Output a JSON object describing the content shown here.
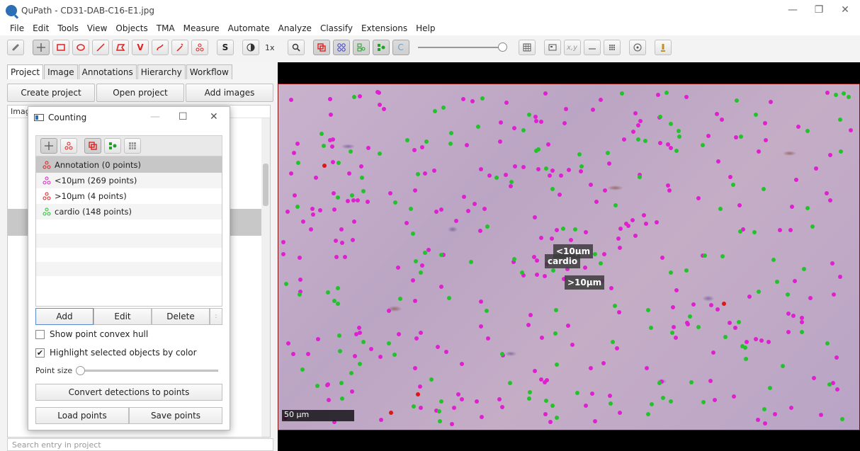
{
  "window": {
    "title": "QuPath - CD31-DAB-C16-E1.jpg"
  },
  "menu": [
    "File",
    "Edit",
    "Tools",
    "View",
    "Objects",
    "TMA",
    "Measure",
    "Automate",
    "Analyze",
    "Classify",
    "Extensions",
    "Help"
  ],
  "toolbar": {
    "zoom_text": "1x",
    "coords_label": "x,y",
    "polygon_label": "V",
    "scale_label": "S",
    "count_c_label": "C"
  },
  "left_panel": {
    "tabs": [
      "Project",
      "Image",
      "Annotations",
      "Hierarchy",
      "Workflow"
    ],
    "active_tab": "Project",
    "buttons": [
      "Create project",
      "Open project",
      "Add images"
    ],
    "list_header": "Imag",
    "search_placeholder": "Search entry in project"
  },
  "counting_dialog": {
    "title": "Counting",
    "classes": [
      {
        "label": "Annotation (0 points)",
        "color": "#e02020",
        "selected": true
      },
      {
        "label": "<10µm (269 points)",
        "color": "#e020d0",
        "selected": false
      },
      {
        "label": ">10µm (4 points)",
        "color": "#e02020",
        "selected": false
      },
      {
        "label": "cardio (148 points)",
        "color": "#22c32a",
        "selected": false
      }
    ],
    "buttons": {
      "add": "Add",
      "edit": "Edit",
      "delete": "Delete",
      "more": ":"
    },
    "show_hull": {
      "label": "Show point convex hull",
      "checked": false
    },
    "highlight": {
      "label": "Highlight selected objects by color",
      "checked": true
    },
    "point_size_label": "Point size",
    "convert_button": "Convert detections to points",
    "load_button": "Load points",
    "save_button": "Save points"
  },
  "viewer": {
    "labels": {
      "small": "<10µm",
      "cardio": "cardio",
      "large": ">10µm"
    },
    "scalebar": "50 µm",
    "colors": {
      "small": "#e020d0",
      "cardio": "#22c32a",
      "large": "#e01616"
    }
  }
}
